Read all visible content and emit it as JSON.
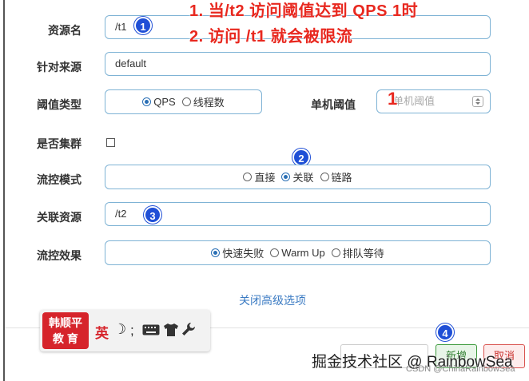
{
  "annotations": {
    "line1": "1. 当/t2 访问阈值达到 QPS 1时",
    "line2": "2. 访问 /t1 就会被限流"
  },
  "badges": {
    "b1": "1",
    "b2": "2",
    "b3": "3",
    "b4": "4",
    "threshold_note": "1"
  },
  "form": {
    "resource_name": {
      "label": "资源名",
      "value": "/t1"
    },
    "limit_app": {
      "label": "针对来源",
      "value": "default"
    },
    "grade": {
      "label": "阈值类型",
      "options": [
        "QPS",
        "线程数"
      ],
      "selected": "QPS"
    },
    "threshold": {
      "label": "单机阈值",
      "placeholder": "单机阈值"
    },
    "cluster": {
      "label": "是否集群"
    },
    "strategy": {
      "label": "流控模式",
      "options": [
        "直接",
        "关联",
        "链路"
      ],
      "selected": "关联"
    },
    "ref_resource": {
      "label": "关联资源",
      "value": "/t2"
    },
    "control_behavior": {
      "label": "流控效果",
      "options": [
        "快速失败",
        "Warm Up",
        "排队等待"
      ],
      "selected": "快速失败"
    }
  },
  "advanced_toggle": "关闭高级选项",
  "ime": {
    "logo_line1": "韩顺平",
    "logo_line2": "教 育",
    "lang": "英",
    "moon": "☽",
    "punct": ";"
  },
  "watermark": {
    "main": "掘金技术社区 @ RainbowSea",
    "small": "CSDN @ChinaRainbowSea"
  },
  "buttons": {
    "add": "新增",
    "cancel": "取消"
  },
  "colors": {
    "annotation": "#e8281f",
    "badge": "#1f4fd6",
    "link": "#3b7bc3",
    "input_border": "#7fb3d5",
    "radio_checked": "#2a6fb5"
  }
}
